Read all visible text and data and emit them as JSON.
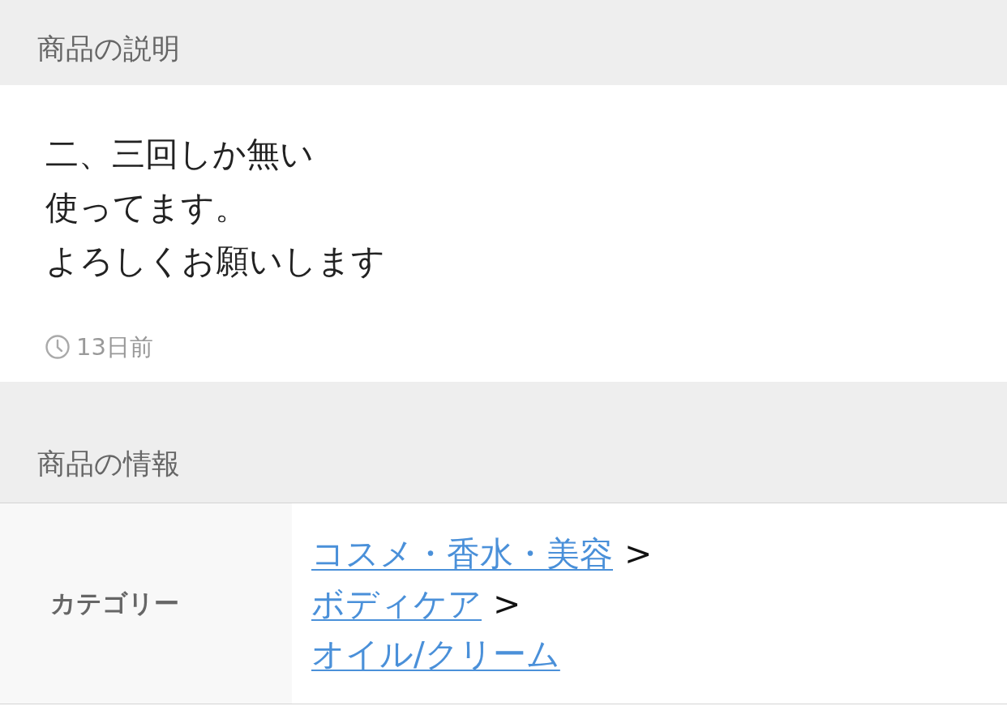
{
  "description_section": {
    "heading": "商品の説明",
    "lines": [
      "二、三回しか無い",
      "使ってます。",
      "よろしくお願いします"
    ],
    "posted": "13日前"
  },
  "info_section": {
    "heading": "商品の情報",
    "rows": [
      {
        "label": "カテゴリー",
        "path": [
          {
            "text": "コスメ・香水・美容",
            "separator": ">"
          },
          {
            "text": "ボディケア",
            "separator": ">"
          },
          {
            "text": "オイル/クリーム"
          }
        ]
      }
    ]
  }
}
